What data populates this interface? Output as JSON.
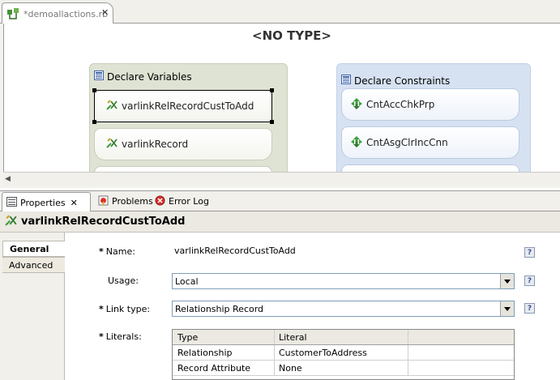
{
  "editor": {
    "tab_label": "*demoallactions.rb",
    "canvas_title": "<NO TYPE>",
    "groups": {
      "variables": {
        "title": "Declare Variables",
        "items": [
          "varlinkRelRecordCustToAdd",
          "varlinkRecord"
        ]
      },
      "constraints": {
        "title": "Declare Constraints",
        "items": [
          "CntAccChkPrp",
          "CntAsgClrIncCnn"
        ]
      }
    }
  },
  "views": {
    "tabs": [
      {
        "label": "Properties",
        "active": true
      },
      {
        "label": "Problems",
        "active": false
      },
      {
        "label": "Error Log",
        "active": false
      }
    ]
  },
  "properties": {
    "title": "varlinkRelRecordCustToAdd",
    "side_tabs": [
      "General",
      "Advanced"
    ],
    "fields": {
      "name_label": "Name:",
      "name_value": "varlinkRelRecordCustToAdd",
      "usage_label": "Usage:",
      "usage_value": "Local",
      "linktype_label": "Link type:",
      "linktype_value": "Relationship Record",
      "literals_label": "Literals:"
    },
    "required_marker": "*",
    "help_glyph": "?",
    "literals_table": {
      "columns": [
        "Type",
        "Literal"
      ],
      "rows": [
        [
          "Relationship",
          "CustomerToAddress"
        ],
        [
          "Record Attribute",
          "None"
        ]
      ]
    }
  },
  "colors": {
    "variables_group_bg": "#dfe3d3",
    "constraints_group_bg": "#d6e2f2",
    "icon_green": "#3f9d3f"
  }
}
